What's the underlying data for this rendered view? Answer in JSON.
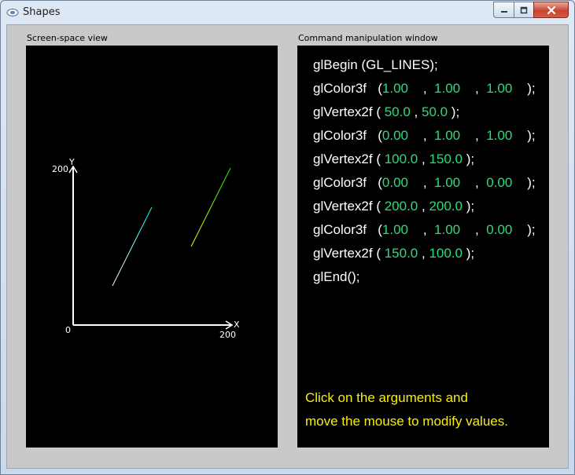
{
  "window": {
    "title": "Shapes"
  },
  "left_panel": {
    "label": "Screen-space view",
    "axis": {
      "x_label": "X",
      "y_label": "Y",
      "origin": "0",
      "x_max_label": "200",
      "y_max_label": "200"
    }
  },
  "right_panel": {
    "label": "Command manipulation window",
    "commands": [
      {
        "text": "glBegin (GL_LINES);"
      },
      {
        "fn": "glColor3f",
        "args": [
          "1.00",
          "1.00",
          "1.00"
        ]
      },
      {
        "fn": "glVertex2f",
        "args": [
          "50.0",
          "50.0"
        ]
      },
      {
        "fn": "glColor3f",
        "args": [
          "0.00",
          "1.00",
          "1.00"
        ]
      },
      {
        "fn": "glVertex2f",
        "args": [
          "100.0",
          "150.0"
        ]
      },
      {
        "fn": "glColor3f",
        "args": [
          "0.00",
          "1.00",
          "0.00"
        ]
      },
      {
        "fn": "glVertex2f",
        "args": [
          "200.0",
          "200.0"
        ]
      },
      {
        "fn": "glColor3f",
        "args": [
          "1.00",
          "1.00",
          "0.00"
        ]
      },
      {
        "fn": "glVertex2f",
        "args": [
          "150.0",
          "100.0"
        ]
      },
      {
        "text": "glEnd();"
      }
    ],
    "hint_lines": [
      "Click on the arguments and",
      "move the mouse to modify values."
    ]
  },
  "colors": {
    "arg": "#22e07a",
    "hint": "#f8f000",
    "panel_bg": "#000000",
    "client_bg": "#c9c9c9"
  }
}
